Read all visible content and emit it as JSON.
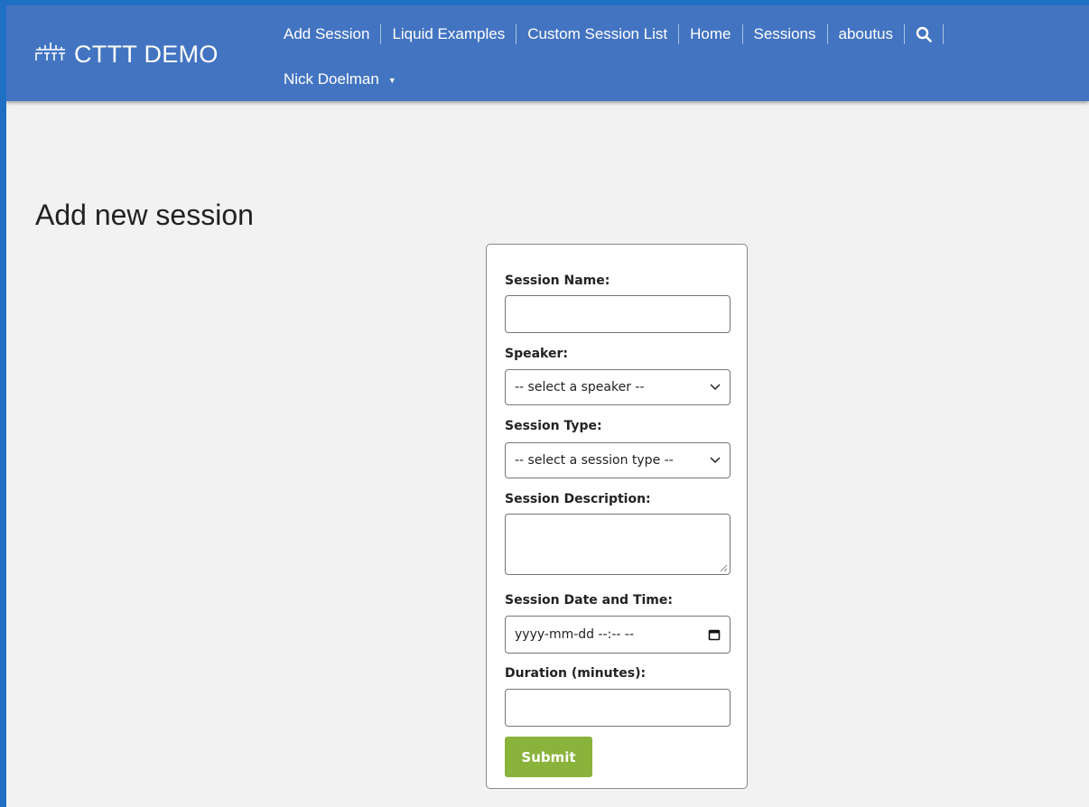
{
  "navbar": {
    "brand": "CTTT DEMO",
    "brand_icon": "cttt-logo-icon",
    "links": [
      "Add Session",
      "Liquid Examples",
      "Custom Session List",
      "Home",
      "Sessions",
      "aboutus"
    ],
    "search_icon": "search-icon",
    "user_name": "Nick Doelman",
    "user_caret_icon": "caret-down-icon"
  },
  "page": {
    "title": "Add new session"
  },
  "form": {
    "session_name": {
      "label": "Session Name:",
      "value": ""
    },
    "speaker": {
      "label": "Speaker:",
      "selected": "-- select a speaker --"
    },
    "session_type": {
      "label": "Session Type:",
      "selected": "-- select a session type --"
    },
    "description": {
      "label": "Session Description:",
      "value": ""
    },
    "date_time": {
      "label": "Session Date and Time:",
      "placeholder": "yyyy-mm-dd --:-- --"
    },
    "duration": {
      "label": "Duration (minutes):",
      "value": ""
    },
    "submit_label": "Submit"
  },
  "colors": {
    "outer_background": "#1f6fc5",
    "navbar": "#4374c1",
    "page_background": "#f2f2f2",
    "submit_button": "#8ab33c"
  }
}
